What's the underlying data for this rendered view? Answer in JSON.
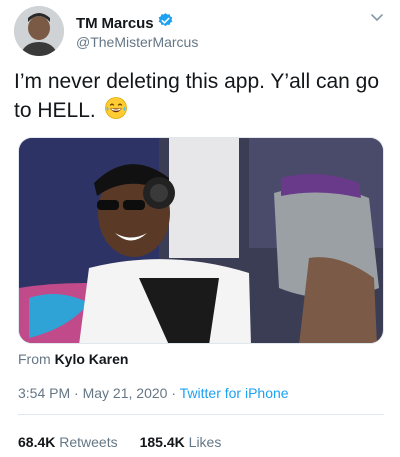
{
  "author": {
    "display_name": "TM Marcus",
    "handle": "@TheMisterMarcus",
    "verified_icon": "verified-badge-icon",
    "avatar_icon": "avatar"
  },
  "tweet": {
    "text": "I’m never deleting this app. Y’all can go to HELL.",
    "emoji_icon": "face-with-tears-of-joy-icon"
  },
  "media": {
    "from_prefix": "From",
    "from_source": "Kylo Karen"
  },
  "meta": {
    "time": "3:54 PM",
    "separator": "·",
    "date": "May 21, 2020",
    "client": "Twitter for iPhone"
  },
  "stats": {
    "retweets_count": "68.4K",
    "retweets_label": "Retweets",
    "likes_count": "185.4K",
    "likes_label": "Likes"
  },
  "colors": {
    "link": "#1da1f2",
    "secondary_text": "#657786",
    "primary_text": "#14171a",
    "divider": "#e1e8ed"
  }
}
